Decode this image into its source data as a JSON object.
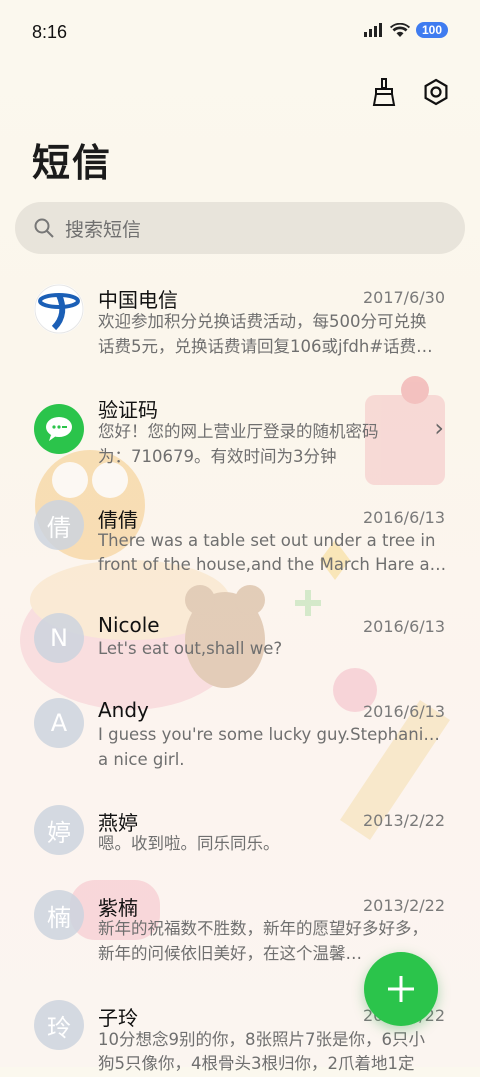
{
  "status_bar": {
    "time": "8:16",
    "battery": "100"
  },
  "toolbar": {
    "clean_icon": "broom-icon",
    "settings_icon": "settings-icon"
  },
  "page": {
    "title": "短信"
  },
  "search": {
    "placeholder": "搜索短信"
  },
  "messages": [
    {
      "name": "中国电信",
      "date": "2017/6/30",
      "line1": "欢迎参加积分兑换话费活动，每500分可兑换",
      "line2": "话费5元，兑换话费请回复106或jfdh#话费…",
      "avatar_type": "logo"
    },
    {
      "name": "验证码",
      "date": "",
      "line1": "您好！您的网上营业厅登录的随机密码",
      "line2": "为：710679。有效时间为3分钟",
      "avatar_type": "sms-icon"
    },
    {
      "name": "倩倩",
      "date": "2016/6/13",
      "avatar": "倩",
      "line1": "There was a table set out under a tree in",
      "line2": "front of the house,and the March Hare an…"
    },
    {
      "name": "Nicole",
      "date": "2016/6/13",
      "avatar": "N",
      "line1": "Let's eat out,shall we?",
      "line2": ""
    },
    {
      "name": "Andy",
      "date": "2016/6/13",
      "avatar": "A",
      "line1": "I guess you're some lucky guy.Stephanie is",
      "line2": "a nice girl."
    },
    {
      "name": "燕婷",
      "date": "2013/2/22",
      "avatar": "婷",
      "line1": "嗯。收到啦。同乐同乐。",
      "line2": ""
    },
    {
      "name": "紫楠",
      "date": "2013/2/22",
      "avatar": "楠",
      "line1": "新年的祝福数不胜数，新年的愿望好多好多，",
      "line2": "新年的问候依旧美好，在这个温馨的时刻，…"
    },
    {
      "name": "子玲",
      "date": "2013/2/22",
      "avatar": "玲",
      "line1": "10分想念9别的你，8张照片7张是你，6只小",
      "line2": "狗5只像你，4根骨头3根归你，2爪着地1定"
    }
  ],
  "fab": {
    "icon": "plus-icon"
  },
  "colors": {
    "accent": "#2bc44b",
    "avatar_bg": "#cdd3de",
    "battery": "#3f7cf0"
  }
}
